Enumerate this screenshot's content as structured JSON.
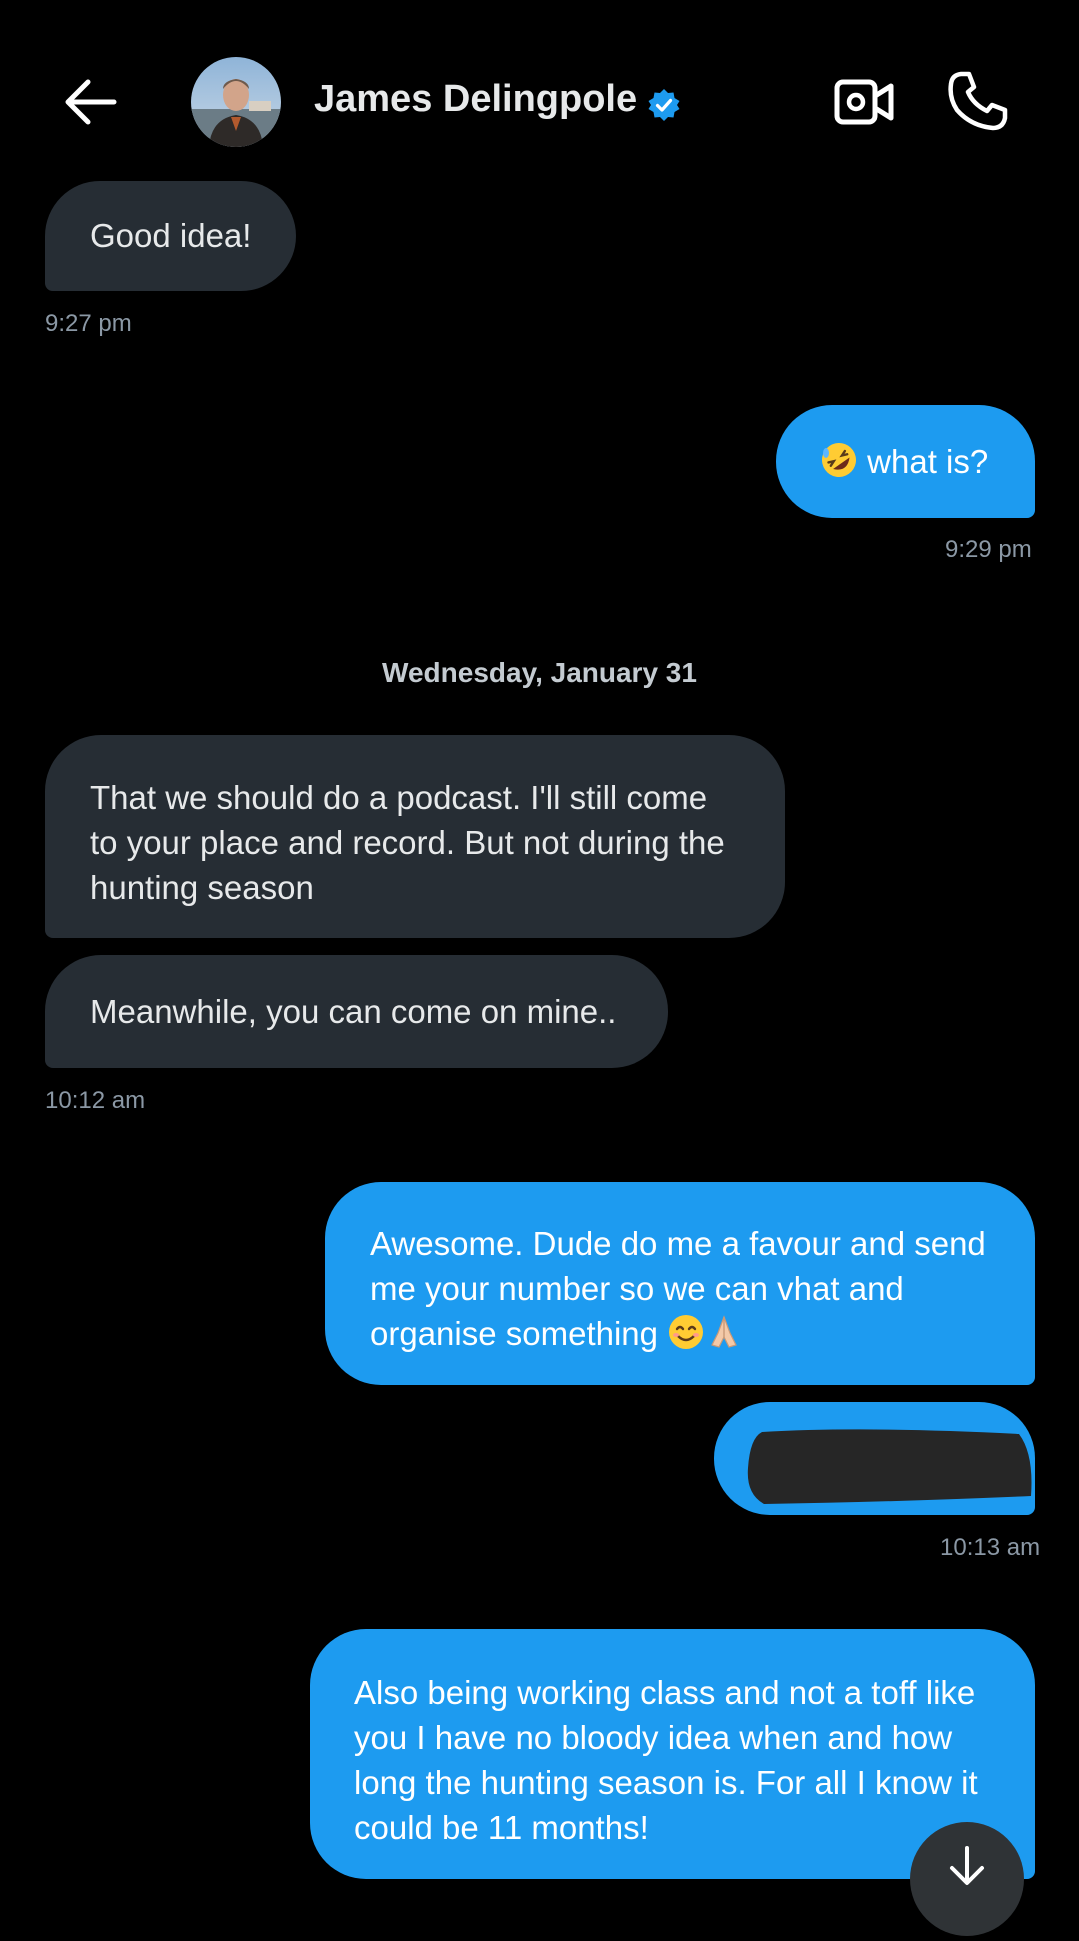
{
  "header": {
    "contact_name": "James Delingpole",
    "verified": true,
    "accent_color": "#1d9bf0"
  },
  "icons": {
    "back": "arrow-left-icon",
    "video": "video-camera-icon",
    "call": "phone-icon",
    "verified": "verified-badge-icon",
    "scroll_down": "arrow-down-icon"
  },
  "messages": [
    {
      "direction": "received",
      "text": "Good idea!"
    },
    {
      "direction": "sent",
      "emoji": "rolling-on-floor-laughing",
      "text": "what is?"
    },
    {
      "direction": "received",
      "lines": [
        "That we should do a podcast. I'll still come",
        "to your place and record. But not during the",
        "hunting season"
      ]
    },
    {
      "direction": "received",
      "text": "Meanwhile, you can come on mine.."
    },
    {
      "direction": "sent",
      "lines": [
        "Awesome. Dude do me a favour and send",
        "me your number so we can vhat and",
        "organise something"
      ],
      "emoji": [
        "smiling-face",
        "folded-hands"
      ]
    },
    {
      "direction": "sent",
      "redacted": true
    },
    {
      "direction": "sent",
      "lines": [
        "Also being working class and not a toff like",
        "you I have no bloody idea when and how",
        "long the hunting season is. For all I know it",
        "could be 11 months!"
      ]
    }
  ],
  "timestamps": {
    "t1": "9:27 pm",
    "t2": "9:29 pm",
    "t3": "10:12 am",
    "t4": "10:13 am"
  },
  "date_separator": "Wednesday, January 31",
  "colors": {
    "background": "#000000",
    "received_bubble": "#262d34",
    "sent_bubble": "#1d9bf0",
    "timestamp": "#8b98a5"
  }
}
